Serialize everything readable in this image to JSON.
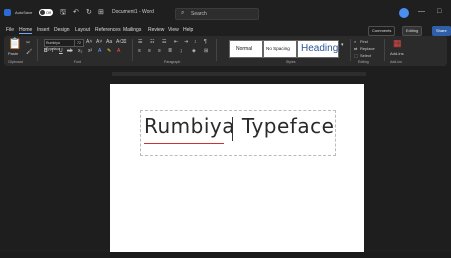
{
  "titlebar": {
    "autosave_label": "AutoSave",
    "autosave_state": "Off",
    "doc_title": "Document1 - Word",
    "search_placeholder": "Search",
    "minimize": "—",
    "close": "□"
  },
  "tabs": [
    "File",
    "Home",
    "Insert",
    "Design",
    "Layout",
    "References",
    "Mailings",
    "Review",
    "View",
    "Help"
  ],
  "ribbon_buttons": {
    "comments": "Comments",
    "editing": "Editing",
    "share": "Share"
  },
  "ribbon": {
    "paste": "Paste",
    "font_name": "Rumbiya Typeface",
    "font_size": "72",
    "styles": [
      "Normal",
      "No Spacing",
      "Heading"
    ],
    "find": "Find",
    "replace": "Replace",
    "select": "Select",
    "addins": "Add-ins",
    "groups": {
      "clipboard": "Clipboard",
      "font": "Font",
      "paragraph": "Paragraph",
      "styles": "Styles",
      "editing": "Editing",
      "addins": "Add-ins"
    }
  },
  "document": {
    "text": "Rumbiya Typeface"
  }
}
